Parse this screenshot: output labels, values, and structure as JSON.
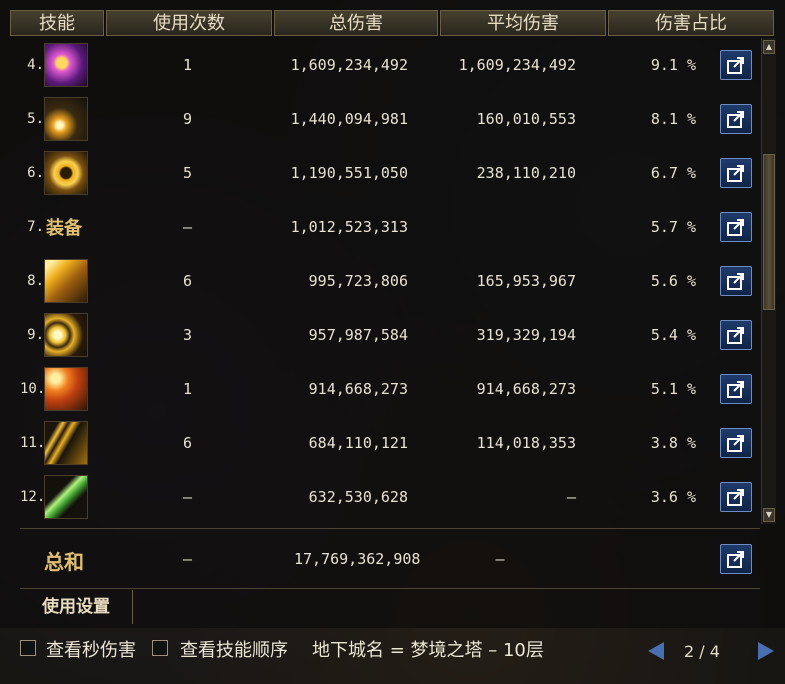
{
  "header": {
    "skill": "技能",
    "uses": "使用次数",
    "total": "总伤害",
    "avg": "平均伤害",
    "share": "伤害占比"
  },
  "rows": [
    {
      "rank": "4.",
      "icon": "purple-burst-skill-icon",
      "uses": "1",
      "total": "1,609,234,492",
      "avg": "1,609,234,492",
      "pct": "9.1 %"
    },
    {
      "rank": "5.",
      "icon": "sparkle-arc-skill-icon",
      "uses": "9",
      "total": "1,440,094,981",
      "avg": "160,010,553",
      "pct": "8.1 %"
    },
    {
      "rank": "6.",
      "icon": "spiral-e-skill-icon",
      "uses": "5",
      "total": "1,190,551,050",
      "avg": "238,110,210",
      "pct": "6.7 %"
    },
    {
      "rank": "7.",
      "label": "装备",
      "uses": "–",
      "total": "1,012,523,313",
      "avg": "",
      "pct": "5.7 %"
    },
    {
      "rank": "8.",
      "icon": "beast-claw-skill-icon",
      "uses": "6",
      "total": "995,723,806",
      "avg": "165,953,967",
      "pct": "5.6 %"
    },
    {
      "rank": "9.",
      "icon": "wave-ring-skill-icon",
      "uses": "3",
      "total": "957,987,584",
      "avg": "319,329,194",
      "pct": "5.4 %"
    },
    {
      "rank": "10.",
      "icon": "fire-rays-skill-icon",
      "uses": "1",
      "total": "914,668,273",
      "avg": "914,668,273",
      "pct": "5.1 %"
    },
    {
      "rank": "11.",
      "icon": "lightning-slash-skill-icon",
      "uses": "6",
      "total": "684,110,121",
      "avg": "114,018,353",
      "pct": "3.8 %"
    },
    {
      "rank": "12.",
      "icon": "green-blade-skill-icon",
      "uses": "–",
      "total": "632,530,628",
      "avg": "–",
      "pct": "3.6 %"
    }
  ],
  "sum": {
    "label": "总和",
    "uses": "–",
    "total": "17,769,362,908",
    "avg": "–"
  },
  "settings_label": "使用设置",
  "bottom": {
    "dps_label": "查看秒伤害",
    "order_label": "查看技能顺序",
    "dungeon_text": "地下城名 = 梦境之塔 – 10层",
    "page_text": "2 / 4"
  },
  "colors": {
    "accent_blue": "#4a6fb0",
    "gold_text": "#e0c070"
  }
}
